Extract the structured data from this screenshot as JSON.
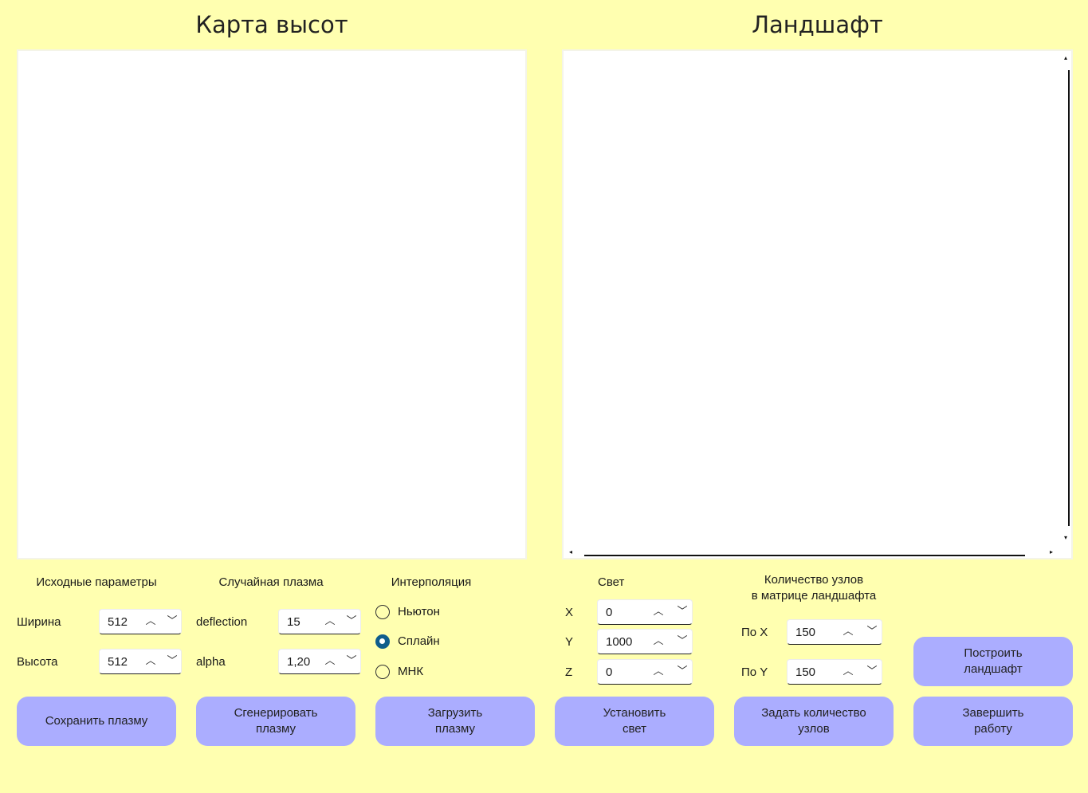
{
  "heightmap": {
    "title": "Карта высот"
  },
  "landscape": {
    "title": "Ландшафт"
  },
  "source_params": {
    "heading": "Исходные параметры",
    "width_label": "Ширина",
    "width_value": "512",
    "height_label": "Высота",
    "height_value": "512"
  },
  "random_plasma": {
    "heading": "Случайная плазма",
    "deflection_label": "deflection",
    "deflection_value": "15",
    "alpha_label": "alpha",
    "alpha_value": "1,20"
  },
  "interpolation": {
    "heading": "Интерполяция",
    "options": [
      {
        "label": "Ньютон",
        "selected": false
      },
      {
        "label": "Сплайн",
        "selected": true
      },
      {
        "label": "МНК",
        "selected": false
      }
    ]
  },
  "light": {
    "heading": "Свет",
    "x_label": "X",
    "x_value": "0",
    "y_label": "Y",
    "y_value": "1000",
    "z_label": "Z",
    "z_value": "0"
  },
  "nodes": {
    "heading_line1": "Количество узлов",
    "heading_line2": "в матрице ландшафта",
    "x_label": "По X",
    "x_value": "150",
    "y_label": "По Y",
    "y_value": "150"
  },
  "buttons": {
    "save_plasma": "Сохранить плазму",
    "generate_plasma": "Сгенерировать\nплазму",
    "load_plasma": "Загрузить\nплазму",
    "set_light": "Установить\nсвет",
    "set_nodes": "Задать количество\nузлов",
    "build_landscape": "Построить\nландшафт",
    "finish": "Завершить\nработу"
  },
  "icons": {
    "spin_up": "chevron-up-icon",
    "spin_down": "chevron-down-icon",
    "scroll_up": "scroll-up-arrow-icon",
    "scroll_down": "scroll-down-arrow-icon",
    "scroll_left": "scroll-left-arrow-icon",
    "scroll_right": "scroll-right-arrow-icon"
  },
  "colors": {
    "background": "#ffffb0",
    "button": "#abadff",
    "radio_selected": "#0f5d8c"
  }
}
